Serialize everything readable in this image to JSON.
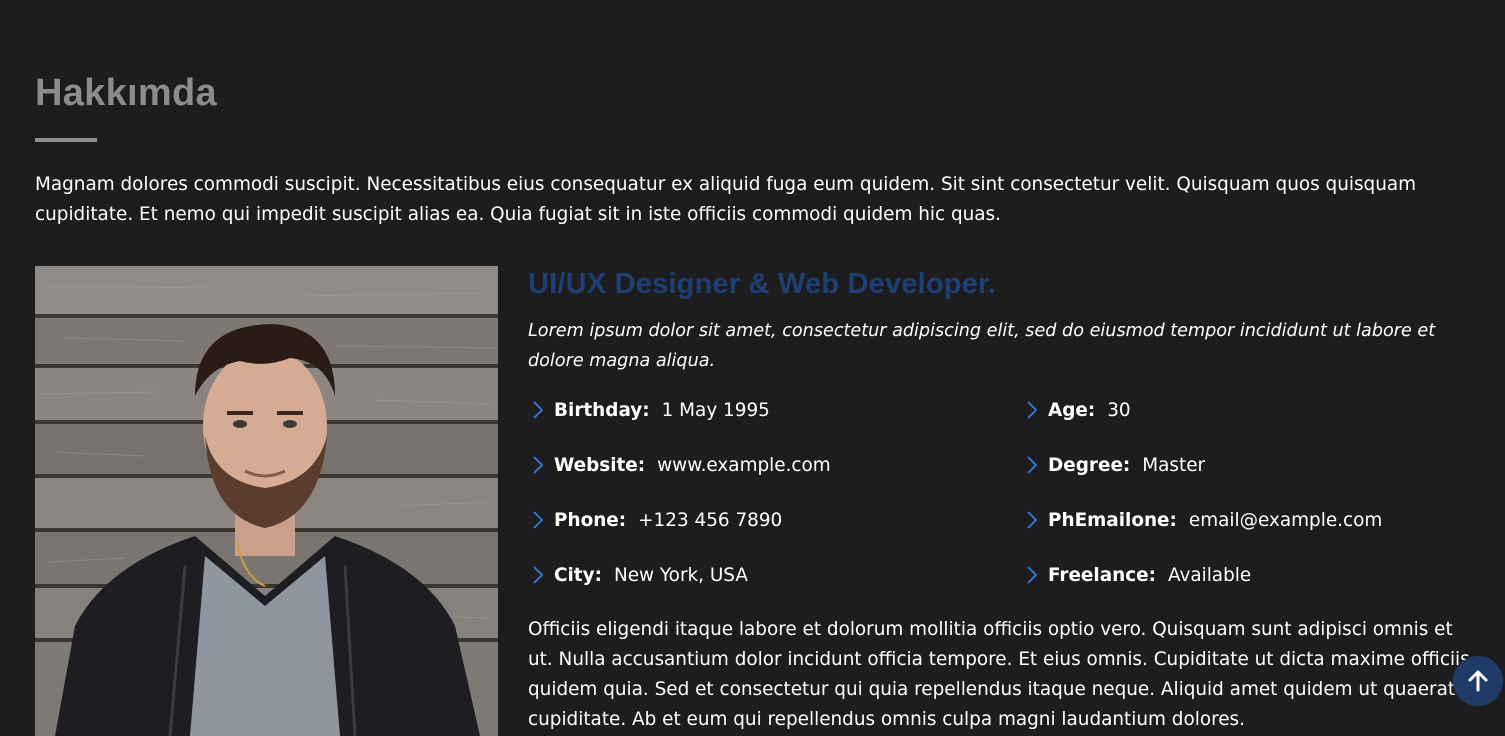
{
  "about": {
    "title": "Hakkımda",
    "intro": "Magnam dolores commodi suscipit. Necessitatibus eius consequatur ex aliquid fuga eum quidem. Sit sint consectetur velit. Quisquam quos quisquam cupiditate. Et nemo qui impedit suscipit alias ea. Quia fugiat sit in iste officiis commodi quidem hic quas."
  },
  "profile": {
    "role": "UI/UX Designer & Web Developer.",
    "tagline": "Lorem ipsum dolor sit amet, consectetur adipiscing elit, sed do eiusmod tempor incididunt ut labore et dolore magna aliqua.",
    "details": [
      {
        "label": "Birthday:",
        "value": "1 May 1995"
      },
      {
        "label": "Website:",
        "value": "www.example.com"
      },
      {
        "label": "Phone:",
        "value": "+123 456 7890"
      },
      {
        "label": "City:",
        "value": "New York, USA"
      },
      {
        "label": "Age:",
        "value": "30"
      },
      {
        "label": "Degree:",
        "value": "Master"
      },
      {
        "label": "PhEmailone:",
        "value": "email@example.com"
      },
      {
        "label": "Freelance:",
        "value": "Available"
      }
    ],
    "body": "Officiis eligendi itaque labore et dolorum mollitia officiis optio vero. Quisquam sunt adipisci omnis et ut. Nulla accusantium dolor incidunt officia tempore. Et eius omnis. Cupiditate ut dicta maxime officiis quidem quia. Sed et consectetur qui quia repellendus itaque neque. Aliquid amet quidem ut quaerat cupiditate. Ab et eum qui repellendus omnis culpa magni laudantium dolores."
  },
  "icons": {
    "detail_bullet": "chevron-right-icon",
    "back_to_top": "arrow-up-icon"
  },
  "colors": {
    "background": "#1d1d1f",
    "accent": "#1e3f73",
    "heading_muted": "#8c8c8c",
    "text": "#ffffff"
  }
}
